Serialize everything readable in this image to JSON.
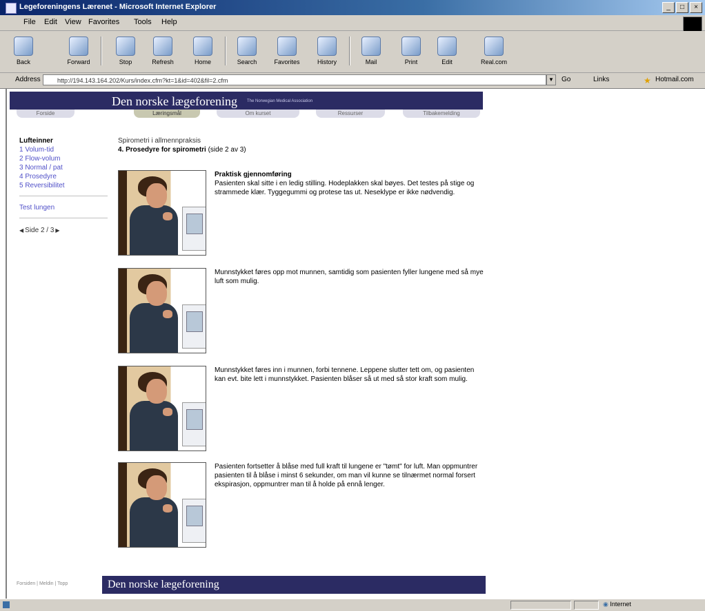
{
  "window": {
    "title": "Legeforeningens Lærenet - Microsoft Internet Explorer",
    "min_glyph": "_",
    "max_glyph": "□",
    "close_glyph": "×"
  },
  "menu": [
    "File",
    "Edit",
    "View",
    "Favorites",
    "Tools",
    "Help"
  ],
  "toolbar": {
    "back": "Back",
    "forward": "Forward",
    "stop": "Stop",
    "refresh": "Refresh",
    "home": "Home",
    "search": "Search",
    "favorites": "Favorites",
    "history": "History",
    "mail": "Mail",
    "print": "Print",
    "edit": "Edit",
    "realcom": "Real.com"
  },
  "address": {
    "label": "Address",
    "url": "http://194.143.164.202/Kurs/index.cfm?kt=1&id=402&fil=2.cfm",
    "go": "Go",
    "links": "Links",
    "favorites_btn": "Hotmail.com"
  },
  "banner": {
    "title": "Den norske lægeforening",
    "subtitle": "The Norwegian Medical Association"
  },
  "tabs": [
    {
      "label": "Forside"
    },
    {
      "label": "Læringsmål"
    },
    {
      "label": "Om kurset"
    },
    {
      "label": "Ressurser"
    },
    {
      "label": "Tilbakemelding"
    }
  ],
  "sidebar": {
    "heading": "Lufteinner",
    "items": [
      {
        "label": "1 Volum-tid"
      },
      {
        "label": "2 Flow-volum"
      },
      {
        "label": "3 Normal / pat"
      },
      {
        "label": "4 Prosedyre"
      },
      {
        "label": "5 Reversibilitet"
      }
    ],
    "test_link": "Test lungen"
  },
  "pager": {
    "prev": "◀",
    "label": "Side 2 / 3",
    "next": "▶"
  },
  "main": {
    "breadcrumb": "Spirometri i allmennpraksis",
    "section_title": "4. Prosedyre for spirometri",
    "section_suffix": " (side 2 av 3)",
    "steps": [
      {
        "title": "Praktisk gjennomføring",
        "text": "Pasienten skal sitte i en ledig stilling. Hodeplakken skal bøyes. Det testes på stige og strammede klær. Tyggegummi og protese tas ut. Neseklype er ikke nødvendig."
      },
      {
        "title": "",
        "text": "Munnstykket føres opp mot munnen, samtidig som pasienten fyller lungene med så mye luft som mulig."
      },
      {
        "title": "",
        "text": "Munnstykket føres inn i munnen, forbi tennene. Leppene slutter tett om, og pasienten kan evt. bite lett i munnstykket. Pasienten blåser så ut med så stor kraft som mulig."
      },
      {
        "title": "",
        "text": "Pasienten fortsetter å blåse med full kraft til lungene er \"tømt\" for luft. Man oppmuntrer pasienten til å blåse i minst 6 sekunder, om man vil kunne se tilnærmet normal forsert ekspirasjon, oppmuntrer man til å holde på ennå lenger."
      }
    ]
  },
  "footer": {
    "links": "Forsiden | Meldin | Topp",
    "title": "Den norske lægeforening"
  },
  "status": {
    "zone": "Internet"
  }
}
